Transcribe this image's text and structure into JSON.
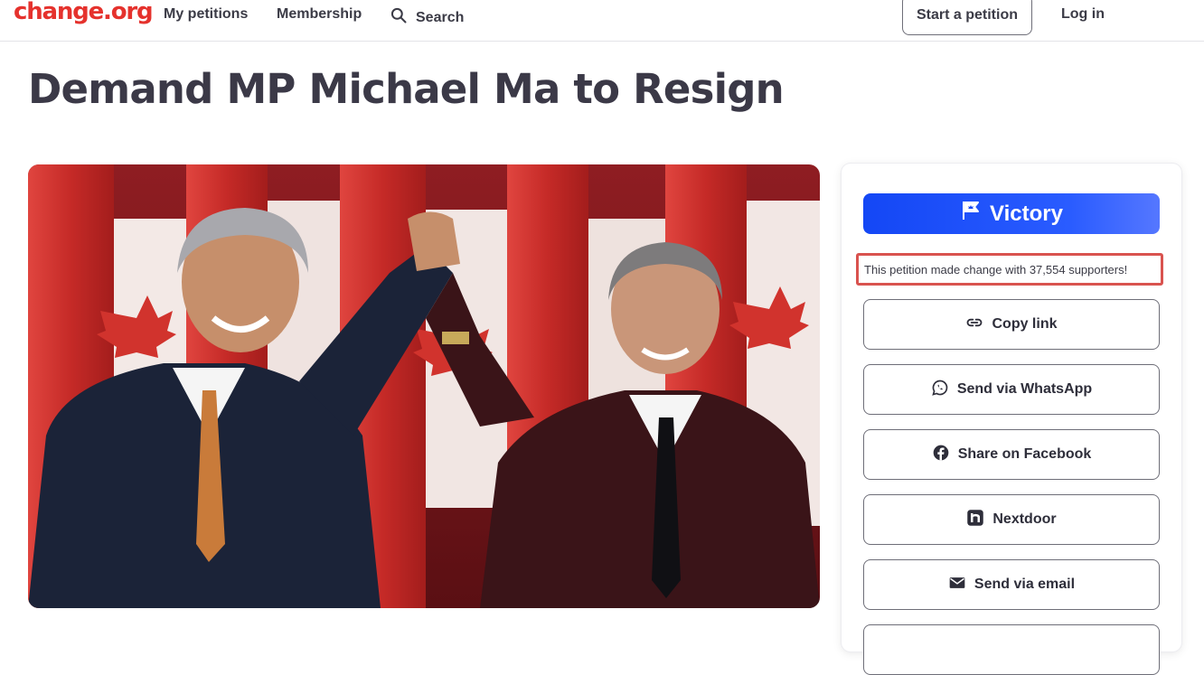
{
  "header": {
    "logo": "change.org",
    "nav": {
      "my_petitions": "My petitions",
      "membership": "Membership",
      "search": "Search",
      "start_petition": "Start a petition",
      "login": "Log in"
    }
  },
  "petition": {
    "title": "Demand MP Michael Ma to Resign",
    "image_alt": "Two men in suits raising joined hands in front of Canadian flags"
  },
  "sidebar": {
    "victory_label": "Victory",
    "victory_message": "This petition made change with 37,554 supporters!",
    "share_buttons": [
      {
        "label": "Copy link",
        "icon": "link-icon"
      },
      {
        "label": "Send via WhatsApp",
        "icon": "whatsapp-icon"
      },
      {
        "label": "Share on Facebook",
        "icon": "facebook-icon"
      },
      {
        "label": "Nextdoor",
        "icon": "nextdoor-icon"
      },
      {
        "label": "Send via email",
        "icon": "email-icon"
      }
    ]
  },
  "colors": {
    "brand_red": "#e5322d",
    "victory_blue": "#1447f5",
    "highlight_border": "#d9534f",
    "title_text": "#3b3947"
  }
}
